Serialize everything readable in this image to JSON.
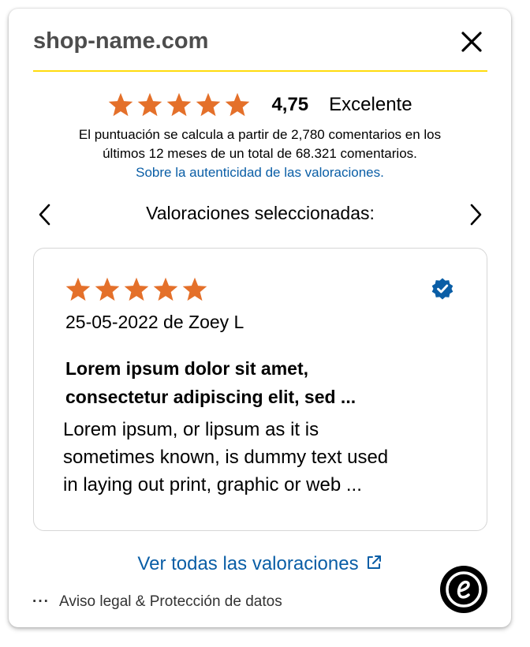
{
  "header": {
    "shop_name": "shop-name.com"
  },
  "summary": {
    "stars": 5,
    "score": "4,75",
    "grade": "Excelente",
    "description_line1": "El puntuación se calcula a partir de 2,780 comentarios en los",
    "description_line2": "últimos 12 meses de un total de 68.321 comentarios.",
    "authenticity_link": "Sobre la autenticidad de las valoraciones."
  },
  "carousel": {
    "title": "Valoraciones seleccionadas:"
  },
  "review": {
    "stars": 5,
    "meta": "25-05-2022 de Zoey L",
    "title_line1": "Lorem ipsum dolor sit amet,",
    "title_line2": "consectetur adipiscing elit, sed ...",
    "body_line1": "Lorem ipsum, or lipsum as it is",
    "body_line2": "sometimes known, is dummy text used",
    "body_line3": "in laying out print, graphic or web ..."
  },
  "footer": {
    "all_reviews_link": "Ver todas las valoraciones",
    "legal": "Aviso legal & Protección de datos"
  },
  "colors": {
    "star": "#e4702a",
    "link": "#0a5ea6",
    "accent_line": "#ffdc0f",
    "verified": "#0a5ea6"
  },
  "icons": {
    "close": "close-icon",
    "prev": "chevron-left-icon",
    "next": "chevron-right-icon",
    "verified": "verified-badge-icon",
    "external": "external-link-icon",
    "more": "more-dots-icon",
    "logo": "trusted-shops-logo-icon"
  }
}
